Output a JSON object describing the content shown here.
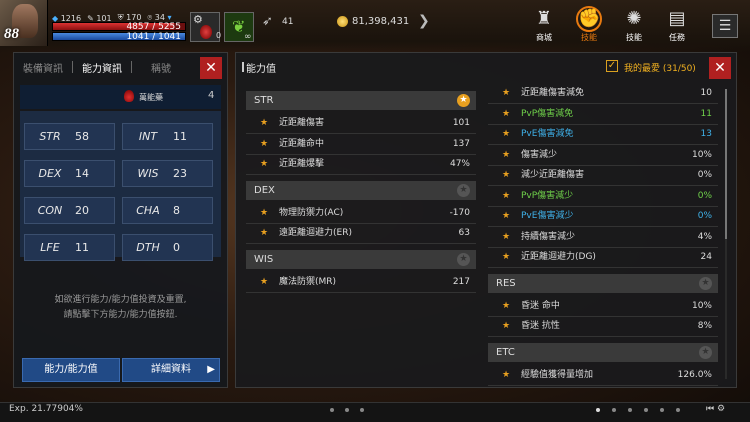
{
  "hud": {
    "level": "88",
    "statsrow": [
      "1216",
      "101",
      "170",
      "34"
    ],
    "hp": "4857 / 5255",
    "hp_fraction": 0.92,
    "mp": "1041 / 1041",
    "mp_fraction": 1.0,
    "potion_count": "0",
    "inf": "∞",
    "feather_count": "41",
    "gold": "81,398,431",
    "menu": {
      "shop": "商城",
      "skill1": "技能",
      "skill2": "技能",
      "mission": "任務"
    }
  },
  "left": {
    "tabs": [
      "裝備資訊",
      "能力資訊",
      "稱號"
    ],
    "potion_label": "萬能藥",
    "potion_value": "4",
    "stats": [
      {
        "k": "STR",
        "v": "58"
      },
      {
        "k": "INT",
        "v": "11"
      },
      {
        "k": "DEX",
        "v": "14"
      },
      {
        "k": "WIS",
        "v": "23"
      },
      {
        "k": "CON",
        "v": "20"
      },
      {
        "k": "CHA",
        "v": "8"
      },
      {
        "k": "LFE",
        "v": "11"
      },
      {
        "k": "DTH",
        "v": "0"
      }
    ],
    "info_line1": "如欲進行能力/能力值投資及重置,",
    "info_line2": "請點擊下方能力/能力值按鈕.",
    "btn_reset": "能力/能力值",
    "btn_detail": "詳細資料"
  },
  "right": {
    "title": "能力值",
    "fav_label": "我的最愛 (31/50)",
    "col1": [
      {
        "head": "STR",
        "fav": true,
        "rows": [
          {
            "lb": "近距離傷害",
            "vl": "101"
          },
          {
            "lb": "近距離命中",
            "vl": "137"
          },
          {
            "lb": "近距離爆擊",
            "vl": "47%"
          }
        ]
      },
      {
        "head": "DEX",
        "fav": false,
        "rows": [
          {
            "lb": "物理防禦力(AC)",
            "vl": "-170"
          },
          {
            "lb": "遠距離迴避力(ER)",
            "vl": "63"
          }
        ]
      },
      {
        "head": "WIS",
        "fav": false,
        "rows": [
          {
            "lb": "魔法防禦(MR)",
            "vl": "217"
          }
        ]
      }
    ],
    "col2_top": [
      {
        "lb": "近距離傷害減免",
        "vl": "10",
        "c": ""
      },
      {
        "lb": "PvP傷害減免",
        "vl": "11",
        "c": "g"
      },
      {
        "lb": "PvE傷害減免",
        "vl": "13",
        "c": "b"
      },
      {
        "lb": "傷害減少",
        "vl": "10%",
        "c": ""
      },
      {
        "lb": "減少近距離傷害",
        "vl": "0%",
        "c": ""
      },
      {
        "lb": "PvP傷害減少",
        "vl": "0%",
        "c": "g"
      },
      {
        "lb": "PvE傷害減少",
        "vl": "0%",
        "c": "b"
      },
      {
        "lb": "持續傷害減少",
        "vl": "4%",
        "c": ""
      },
      {
        "lb": "近距離迴避力(DG)",
        "vl": "24",
        "c": ""
      }
    ],
    "res": {
      "head": "RES",
      "rows": [
        {
          "lb": "昏迷 命中",
          "vl": "10%"
        },
        {
          "lb": "昏迷 抗性",
          "vl": "8%"
        }
      ]
    },
    "etc": {
      "head": "ETC",
      "rows": [
        {
          "lb": "經驗值獲得量增加",
          "vl": "126.0%"
        }
      ]
    }
  },
  "footer": {
    "exp": "Exp. 21.77904%"
  }
}
